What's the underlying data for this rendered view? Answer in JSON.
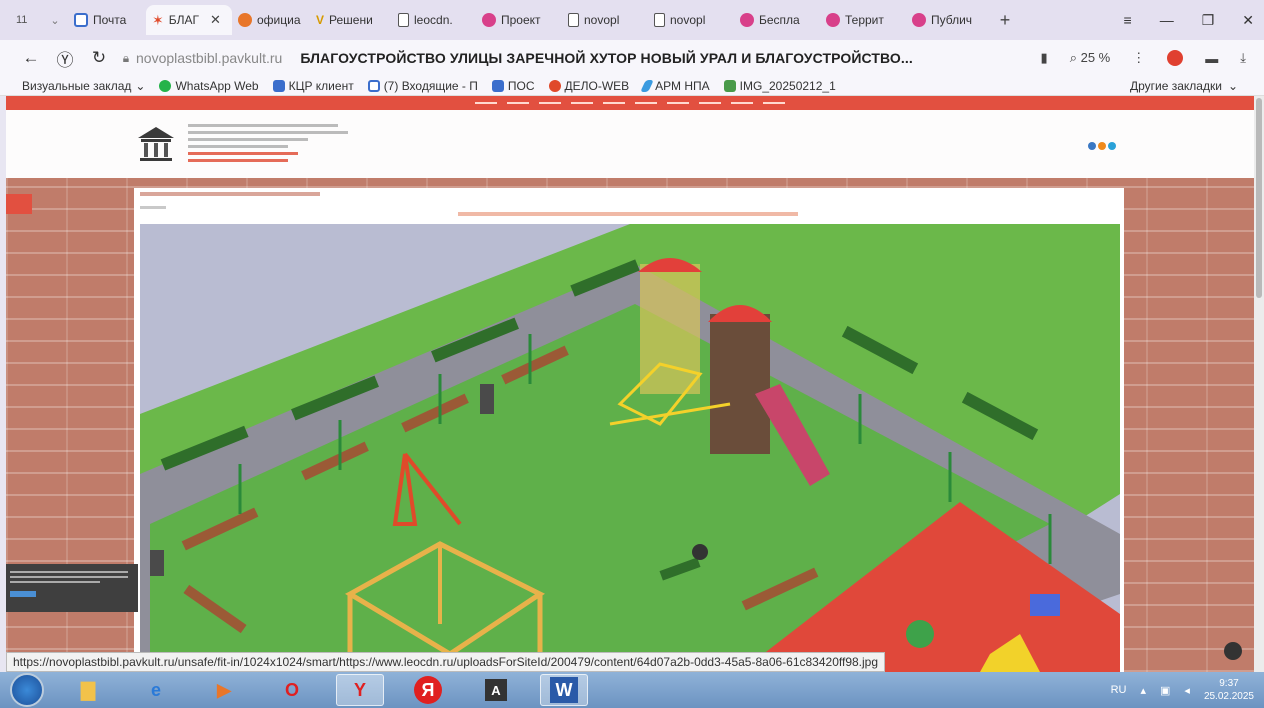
{
  "browser": {
    "tab_count": "11",
    "tabs": [
      {
        "label": "Почта",
        "icon": "mail-icon",
        "active": false
      },
      {
        "label": "БЛАГ",
        "icon": "star-icon",
        "active": true
      },
      {
        "label": "официа",
        "icon": "browser-icon",
        "active": false
      },
      {
        "label": "Решени",
        "icon": "v-icon",
        "active": false
      },
      {
        "label": "leocdn.",
        "icon": "document-icon",
        "active": false
      },
      {
        "label": "Проект",
        "icon": "browser-icon",
        "active": false
      },
      {
        "label": "novopl",
        "icon": "document-icon",
        "active": false
      },
      {
        "label": "novopl",
        "icon": "document-icon",
        "active": false
      },
      {
        "label": "Беспла",
        "icon": "browser-icon",
        "active": false
      },
      {
        "label": "Террит",
        "icon": "browser-icon",
        "active": false
      },
      {
        "label": "Публич",
        "icon": "browser-icon",
        "active": false
      }
    ],
    "address": {
      "domain": "novoplastbibl.pavkult.ru",
      "title": "БЛАГОУСТРОЙСТВО УЛИЦЫ ЗАРЕЧНОЙ ХУТОР НОВЫЙ УРАЛ И БЛАГОУСТРОЙСТВО..."
    },
    "zoom": "25 %",
    "bookmarks": [
      {
        "label": "Визуальные заклад",
        "color": ""
      },
      {
        "label": "WhatsApp Web",
        "color": "#25b34a"
      },
      {
        "label": "КЦР клиент",
        "color": "#3b6ecc"
      },
      {
        "label": "(7) Входящие - П",
        "color": "#3b6ecc"
      },
      {
        "label": "ПОС",
        "color": "#3b6ecc"
      },
      {
        "label": "ДЕЛО-WEB",
        "color": "#e04a2a"
      },
      {
        "label": "АРМ НПА",
        "color": "#3b9be0"
      },
      {
        "label": "IMG_20250212_1",
        "color": "#4a9a4a"
      }
    ],
    "other_bookmarks": "Другие закладки"
  },
  "site": {
    "accent_color": "#e25040"
  },
  "status_url": "https://novoplastbibl.pavkult.ru/unsafe/fit-in/1024x1024/smart/https://www.leocdn.ru/uploadsForSiteId/200479/content/64d07a2b-0dd3-45a5-8a06-61c83420ff98.jpg",
  "taskbar": {
    "apps": [
      "explorer",
      "internet-explorer",
      "media-player",
      "opera",
      "yandex-browser",
      "yandex",
      "app-a",
      "word"
    ],
    "lang": "RU",
    "time": "9:37",
    "date": "25.02.2025"
  }
}
